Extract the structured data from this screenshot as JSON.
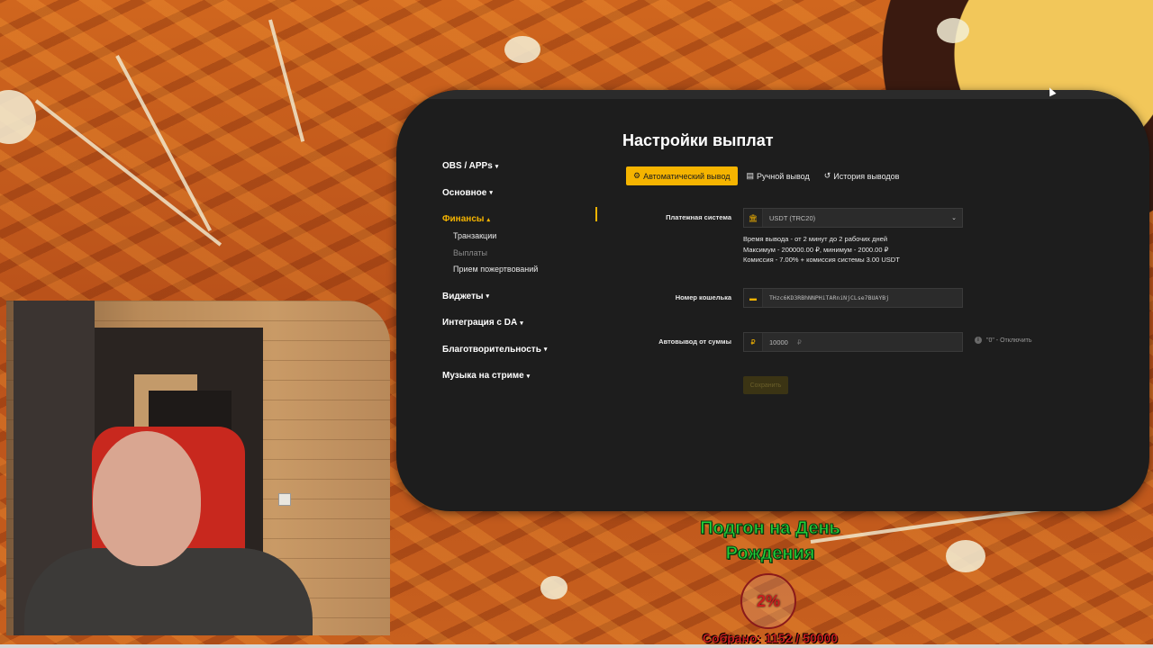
{
  "sidebar": {
    "items": [
      {
        "label": "OBS / APPs",
        "caret": "▾"
      },
      {
        "label": "Основное",
        "caret": "▾"
      },
      {
        "label": "Финансы",
        "caret": "▴"
      },
      {
        "label": "Виджеты",
        "caret": "▾"
      },
      {
        "label": "Интеграция с DA",
        "caret": "▾"
      },
      {
        "label": "Благотворительность",
        "caret": "▾"
      },
      {
        "label": "Музыка на стриме",
        "caret": "▾"
      }
    ],
    "finance_sub": [
      "Транзакции",
      "Выплаты",
      "Прием пожертвований"
    ]
  },
  "page": {
    "title": "Настройки выплат"
  },
  "tabs": [
    {
      "label": "Автоматический вывод",
      "icon": "gear-icon"
    },
    {
      "label": "Ручной вывод",
      "icon": "card-icon"
    },
    {
      "label": "История выводов",
      "icon": "history-icon"
    }
  ],
  "form": {
    "payment_system": {
      "label": "Платежная система",
      "value": "USDT (TRC20)"
    },
    "info_lines": [
      "Время вывода - от 2 минут до 2 рабочих дней",
      "Максимум  -  200000.00 ₽, минимум  -  2000.00 ₽",
      "Комиссия  -  7.00% + комиссия системы 3.00 USDT"
    ],
    "wallet": {
      "label": "Номер кошелька",
      "value": "THzc6KD3RBhNNPHiTARniNjCLse7BUAYBj"
    },
    "auto_withdraw": {
      "label": "Автовывод от суммы",
      "currency": "₽",
      "value": "10000",
      "unit": "₽"
    },
    "hint": "\"0\" - Отключить",
    "save_label": "Сохранить"
  },
  "goal": {
    "title": "Подгон на День Рождения",
    "percent": "2%",
    "collected": "Собрано: 1152 / 50000",
    "progress": 0.023
  },
  "colors": {
    "accent": "#f5b400",
    "panel": "#1d1d1d",
    "goal_title": "#22d13a",
    "goal_collected": "#c81e1e"
  }
}
